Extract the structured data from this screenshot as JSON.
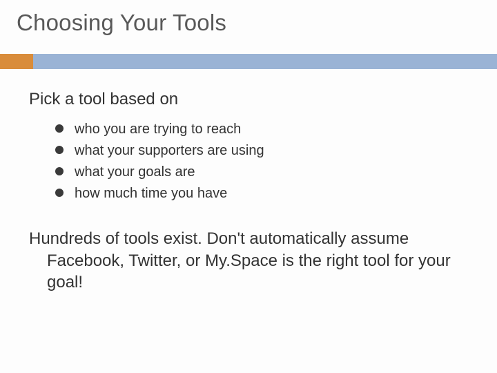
{
  "title": "Choosing Your Tools",
  "lead": "Pick a tool based on",
  "bullets": [
    "who you are trying to reach",
    "what your supporters are using",
    "what your goals are",
    "how much time you have"
  ],
  "paragraph": "Hundreds of tools exist. Don't automatically assume Facebook, Twitter, or My.Space is the right tool for your goal!",
  "colors": {
    "accent": "#d98c3a",
    "bar": "#9ab3d5"
  }
}
